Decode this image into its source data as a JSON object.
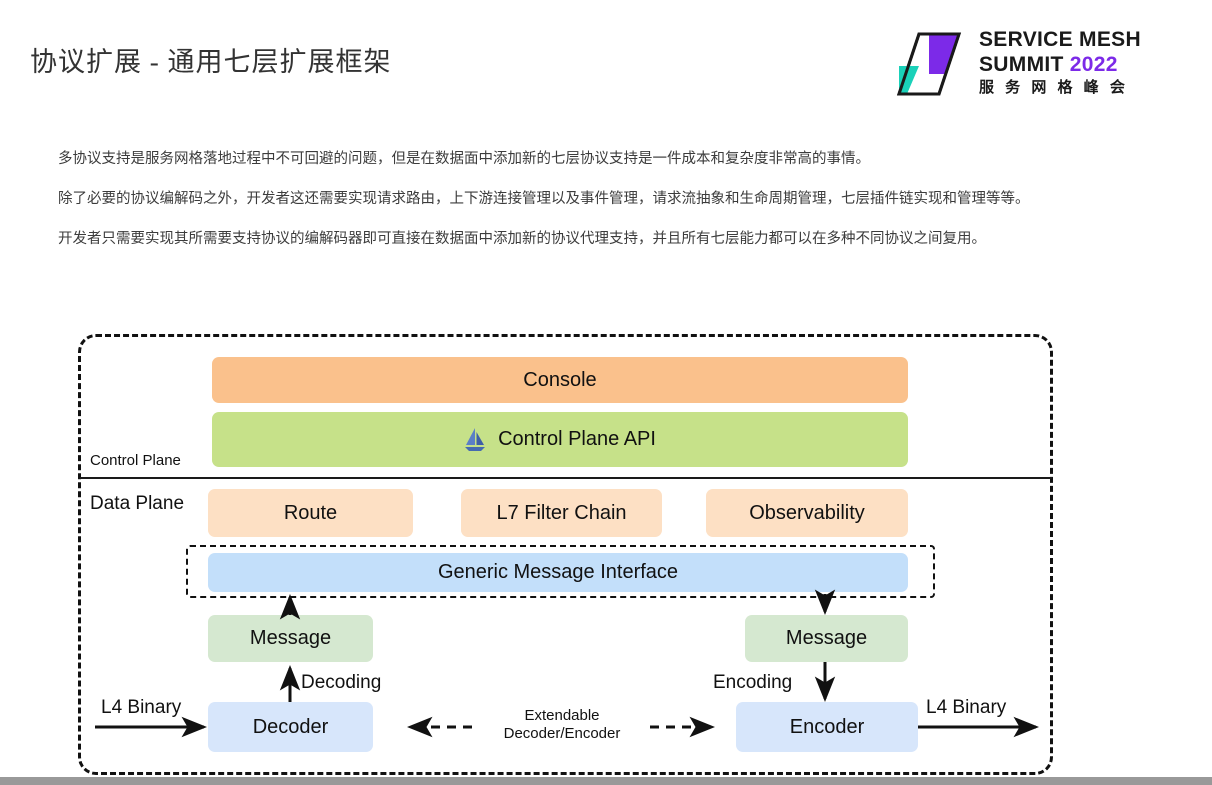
{
  "header": {
    "title": "协议扩展 - 通用七层扩展框架",
    "logo": {
      "line1": "SERVICE MESH",
      "line2_prefix": "SUMMIT ",
      "line2_year": "2022",
      "line3": "服 务 网 格 峰 会",
      "mark_purple": "#7c2ae8",
      "mark_teal": "#1ad1b9",
      "mark_dark": "#1a1a1a"
    }
  },
  "body_paragraphs": [
    "多协议支持是服务网格落地过程中不可回避的问题，但是在数据面中添加新的七层协议支持是一件成本和复杂度非常高的事情。",
    "除了必要的协议编解码之外，开发者这还需要实现请求路由，上下游连接管理以及事件管理，请求流抽象和生命周期管理，七层插件链实现和管理等等。",
    "开发者只需要实现其所需要支持协议的编解码器即可直接在数据面中添加新的协议代理支持，并且所有七层能力都可以在多种不同协议之间复用。"
  ],
  "diagram": {
    "plane_labels": {
      "control": "Control Plane",
      "data": "Data Plane"
    },
    "boxes": {
      "console": "Console",
      "control_plane_api": "Control Plane API",
      "route": "Route",
      "l7_filter_chain": "L7 Filter Chain",
      "observability": "Observability",
      "generic_message_interface": "Generic Message Interface",
      "message_left": "Message",
      "message_right": "Message",
      "decoder": "Decoder",
      "encoder": "Encoder"
    },
    "edge_labels": {
      "decoding": "Decoding",
      "encoding": "Encoding",
      "l4_binary_in": "L4 Binary",
      "l4_binary_out": "L4 Binary",
      "extendable_line1": "Extendable",
      "extendable_line2": "Decoder/Encoder"
    },
    "colors": {
      "console_bg": "#fac18c",
      "control_plane_api_bg": "#c6e189",
      "filter_bg": "#fde0c4",
      "interface_bg": "#c3dffa",
      "message_bg": "#d5e8d0",
      "codec_bg": "#d7e6fb",
      "istio_icon": "#466bb0",
      "stroke": "#111111"
    }
  }
}
